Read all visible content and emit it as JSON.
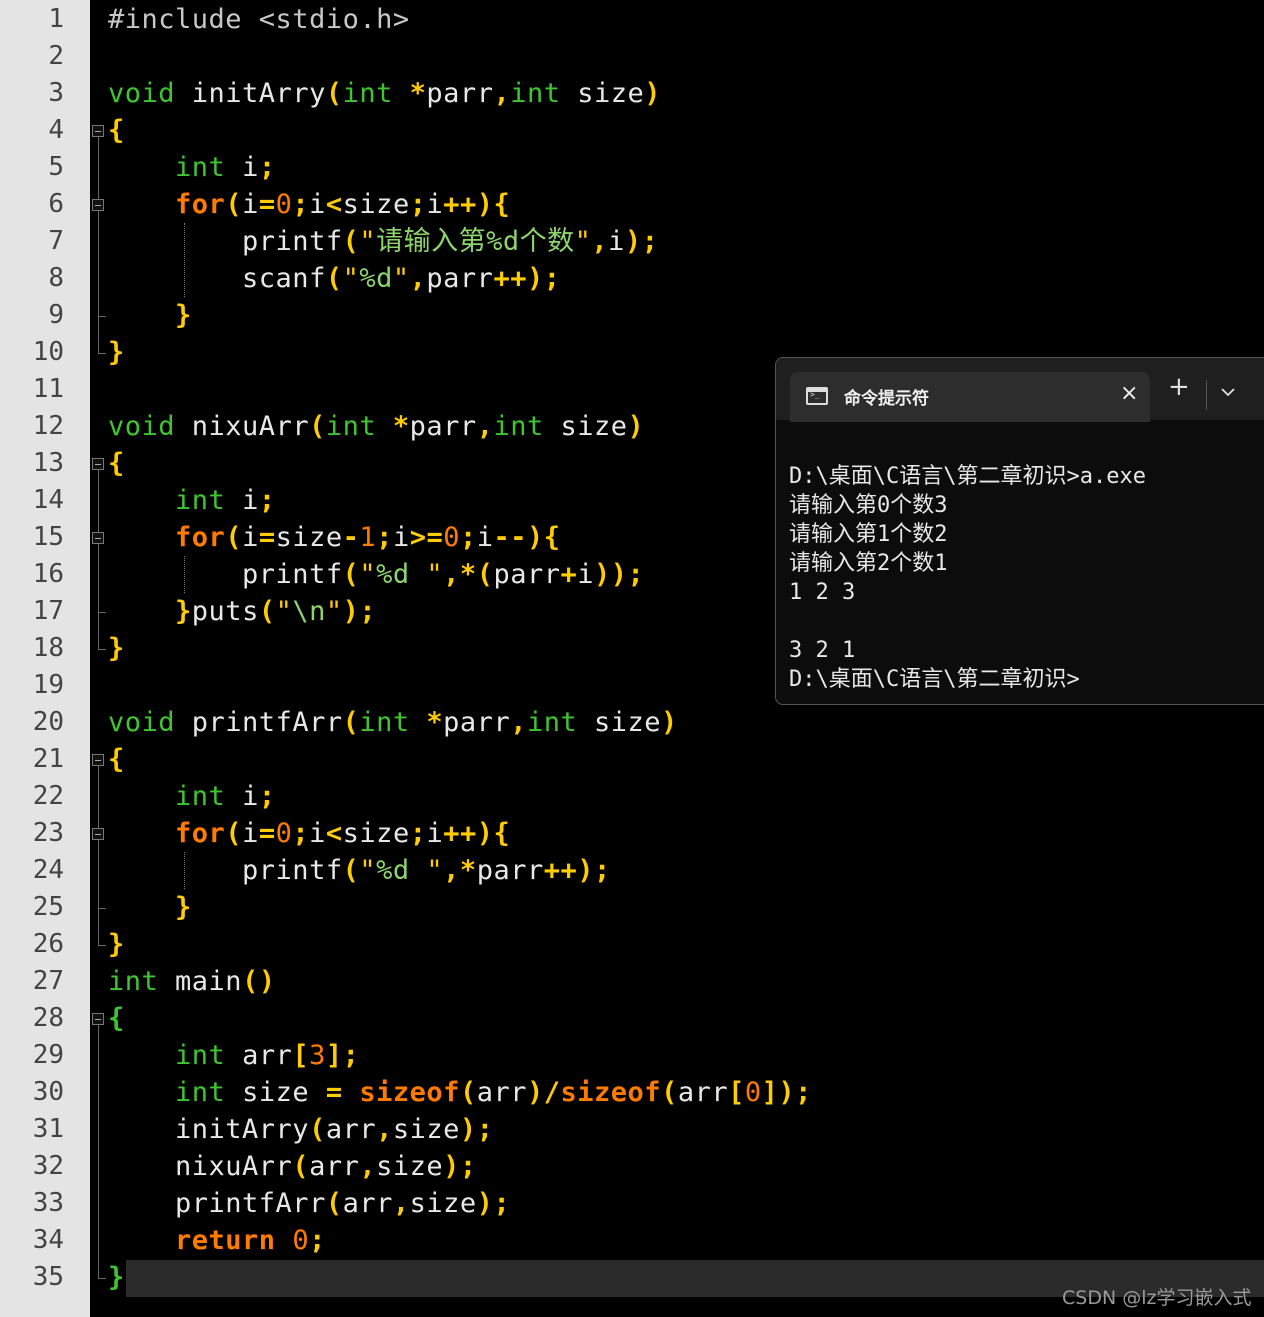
{
  "editor": {
    "line_numbers": [
      "1",
      "2",
      "3",
      "4",
      "5",
      "6",
      "7",
      "8",
      "9",
      "10",
      "11",
      "12",
      "13",
      "14",
      "15",
      "16",
      "17",
      "18",
      "19",
      "20",
      "21",
      "22",
      "23",
      "24",
      "25",
      "26",
      "27",
      "28",
      "29",
      "30",
      "31",
      "32",
      "33",
      "34",
      "35"
    ],
    "lines": [
      [
        {
          "t": "#include <stdio.h>",
          "c": "pp"
        }
      ],
      [],
      [
        {
          "t": "void",
          "c": "kw-type"
        },
        {
          "t": " initArry",
          "c": ""
        },
        {
          "t": "(",
          "c": "op"
        },
        {
          "t": "int",
          "c": "kw-type"
        },
        {
          "t": " ",
          "c": ""
        },
        {
          "t": "*",
          "c": "op"
        },
        {
          "t": "parr",
          "c": ""
        },
        {
          "t": ",",
          "c": "op"
        },
        {
          "t": "int",
          "c": "kw-type"
        },
        {
          "t": " size",
          "c": ""
        },
        {
          "t": ")",
          "c": "op"
        }
      ],
      [
        {
          "t": "{",
          "c": "brace"
        }
      ],
      [
        {
          "t": "    ",
          "c": ""
        },
        {
          "t": "int",
          "c": "kw-type"
        },
        {
          "t": " i",
          "c": ""
        },
        {
          "t": ";",
          "c": "op"
        }
      ],
      [
        {
          "t": "    ",
          "c": ""
        },
        {
          "t": "for",
          "c": "kw-ctrl"
        },
        {
          "t": "(",
          "c": "op"
        },
        {
          "t": "i",
          "c": ""
        },
        {
          "t": "=",
          "c": "op"
        },
        {
          "t": "0",
          "c": "num"
        },
        {
          "t": ";",
          "c": "op"
        },
        {
          "t": "i",
          "c": ""
        },
        {
          "t": "<",
          "c": "op"
        },
        {
          "t": "size",
          "c": ""
        },
        {
          "t": ";",
          "c": "op"
        },
        {
          "t": "i",
          "c": ""
        },
        {
          "t": "++",
          "c": "op"
        },
        {
          "t": ")",
          "c": "op"
        },
        {
          "t": "{",
          "c": "brace"
        }
      ],
      [
        {
          "t": "        printf",
          "c": ""
        },
        {
          "t": "(",
          "c": "op"
        },
        {
          "t": "\"",
          "c": "str"
        },
        {
          "t": "请输入第%d个数",
          "c": "strt"
        },
        {
          "t": "\"",
          "c": "str"
        },
        {
          "t": ",",
          "c": "op"
        },
        {
          "t": "i",
          "c": ""
        },
        {
          "t": ")",
          "c": "op"
        },
        {
          "t": ";",
          "c": "op"
        }
      ],
      [
        {
          "t": "        scanf",
          "c": ""
        },
        {
          "t": "(",
          "c": "op"
        },
        {
          "t": "\"",
          "c": "str"
        },
        {
          "t": "%d",
          "c": "strt"
        },
        {
          "t": "\"",
          "c": "str"
        },
        {
          "t": ",",
          "c": "op"
        },
        {
          "t": "parr",
          "c": ""
        },
        {
          "t": "++",
          "c": "op"
        },
        {
          "t": ")",
          "c": "op"
        },
        {
          "t": ";",
          "c": "op"
        }
      ],
      [
        {
          "t": "    ",
          "c": ""
        },
        {
          "t": "}",
          "c": "brace"
        }
      ],
      [
        {
          "t": "}",
          "c": "brace"
        }
      ],
      [],
      [
        {
          "t": "void",
          "c": "kw-type"
        },
        {
          "t": " nixuArr",
          "c": ""
        },
        {
          "t": "(",
          "c": "op"
        },
        {
          "t": "int",
          "c": "kw-type"
        },
        {
          "t": " ",
          "c": ""
        },
        {
          "t": "*",
          "c": "op"
        },
        {
          "t": "parr",
          "c": ""
        },
        {
          "t": ",",
          "c": "op"
        },
        {
          "t": "int",
          "c": "kw-type"
        },
        {
          "t": " size",
          "c": ""
        },
        {
          "t": ")",
          "c": "op"
        }
      ],
      [
        {
          "t": "{",
          "c": "brace"
        }
      ],
      [
        {
          "t": "    ",
          "c": ""
        },
        {
          "t": "int",
          "c": "kw-type"
        },
        {
          "t": " i",
          "c": ""
        },
        {
          "t": ";",
          "c": "op"
        }
      ],
      [
        {
          "t": "    ",
          "c": ""
        },
        {
          "t": "for",
          "c": "kw-ctrl"
        },
        {
          "t": "(",
          "c": "op"
        },
        {
          "t": "i",
          "c": ""
        },
        {
          "t": "=",
          "c": "op"
        },
        {
          "t": "size",
          "c": ""
        },
        {
          "t": "-",
          "c": "op"
        },
        {
          "t": "1",
          "c": "num"
        },
        {
          "t": ";",
          "c": "op"
        },
        {
          "t": "i",
          "c": ""
        },
        {
          "t": ">=",
          "c": "op"
        },
        {
          "t": "0",
          "c": "num"
        },
        {
          "t": ";",
          "c": "op"
        },
        {
          "t": "i",
          "c": ""
        },
        {
          "t": "--",
          "c": "op"
        },
        {
          "t": ")",
          "c": "op"
        },
        {
          "t": "{",
          "c": "brace"
        }
      ],
      [
        {
          "t": "        printf",
          "c": ""
        },
        {
          "t": "(",
          "c": "op"
        },
        {
          "t": "\"",
          "c": "str"
        },
        {
          "t": "%d ",
          "c": "strt"
        },
        {
          "t": "\"",
          "c": "str"
        },
        {
          "t": ",",
          "c": "op"
        },
        {
          "t": "*",
          "c": "op"
        },
        {
          "t": "(",
          "c": "op"
        },
        {
          "t": "parr",
          "c": ""
        },
        {
          "t": "+",
          "c": "op"
        },
        {
          "t": "i",
          "c": ""
        },
        {
          "t": ")",
          "c": "op"
        },
        {
          "t": ")",
          "c": "op"
        },
        {
          "t": ";",
          "c": "op"
        }
      ],
      [
        {
          "t": "    ",
          "c": ""
        },
        {
          "t": "}",
          "c": "brace"
        },
        {
          "t": "puts",
          "c": ""
        },
        {
          "t": "(",
          "c": "op"
        },
        {
          "t": "\"",
          "c": "str"
        },
        {
          "t": "\\n",
          "c": "strt"
        },
        {
          "t": "\"",
          "c": "str"
        },
        {
          "t": ")",
          "c": "op"
        },
        {
          "t": ";",
          "c": "op"
        }
      ],
      [
        {
          "t": "}",
          "c": "brace"
        }
      ],
      [],
      [
        {
          "t": "void",
          "c": "kw-type"
        },
        {
          "t": " printfArr",
          "c": ""
        },
        {
          "t": "(",
          "c": "op"
        },
        {
          "t": "int",
          "c": "kw-type"
        },
        {
          "t": " ",
          "c": ""
        },
        {
          "t": "*",
          "c": "op"
        },
        {
          "t": "parr",
          "c": ""
        },
        {
          "t": ",",
          "c": "op"
        },
        {
          "t": "int",
          "c": "kw-type"
        },
        {
          "t": " size",
          "c": ""
        },
        {
          "t": ")",
          "c": "op"
        }
      ],
      [
        {
          "t": "{",
          "c": "brace"
        }
      ],
      [
        {
          "t": "    ",
          "c": ""
        },
        {
          "t": "int",
          "c": "kw-type"
        },
        {
          "t": " i",
          "c": ""
        },
        {
          "t": ";",
          "c": "op"
        }
      ],
      [
        {
          "t": "    ",
          "c": ""
        },
        {
          "t": "for",
          "c": "kw-ctrl"
        },
        {
          "t": "(",
          "c": "op"
        },
        {
          "t": "i",
          "c": ""
        },
        {
          "t": "=",
          "c": "op"
        },
        {
          "t": "0",
          "c": "num"
        },
        {
          "t": ";",
          "c": "op"
        },
        {
          "t": "i",
          "c": ""
        },
        {
          "t": "<",
          "c": "op"
        },
        {
          "t": "size",
          "c": ""
        },
        {
          "t": ";",
          "c": "op"
        },
        {
          "t": "i",
          "c": ""
        },
        {
          "t": "++",
          "c": "op"
        },
        {
          "t": ")",
          "c": "op"
        },
        {
          "t": "{",
          "c": "brace"
        }
      ],
      [
        {
          "t": "        printf",
          "c": ""
        },
        {
          "t": "(",
          "c": "op"
        },
        {
          "t": "\"",
          "c": "str"
        },
        {
          "t": "%d ",
          "c": "strt"
        },
        {
          "t": "\"",
          "c": "str"
        },
        {
          "t": ",",
          "c": "op"
        },
        {
          "t": "*",
          "c": "op"
        },
        {
          "t": "parr",
          "c": ""
        },
        {
          "t": "++",
          "c": "op"
        },
        {
          "t": ")",
          "c": "op"
        },
        {
          "t": ";",
          "c": "op"
        }
      ],
      [
        {
          "t": "    ",
          "c": ""
        },
        {
          "t": "}",
          "c": "brace"
        }
      ],
      [
        {
          "t": "}",
          "c": "brace"
        }
      ],
      [
        {
          "t": "int",
          "c": "kw-type"
        },
        {
          "t": " main",
          "c": ""
        },
        {
          "t": "()",
          "c": "op"
        }
      ],
      [
        {
          "t": "{",
          "c": "brace-g"
        }
      ],
      [
        {
          "t": "    ",
          "c": ""
        },
        {
          "t": "int",
          "c": "kw-type"
        },
        {
          "t": " arr",
          "c": ""
        },
        {
          "t": "[",
          "c": "op"
        },
        {
          "t": "3",
          "c": "num"
        },
        {
          "t": "]",
          "c": "op"
        },
        {
          "t": ";",
          "c": "op"
        }
      ],
      [
        {
          "t": "    ",
          "c": ""
        },
        {
          "t": "int",
          "c": "kw-type"
        },
        {
          "t": " size ",
          "c": ""
        },
        {
          "t": "=",
          "c": "op"
        },
        {
          "t": " ",
          "c": ""
        },
        {
          "t": "sizeof",
          "c": "kw-ctrl"
        },
        {
          "t": "(",
          "c": "op"
        },
        {
          "t": "arr",
          "c": ""
        },
        {
          "t": ")",
          "c": "op"
        },
        {
          "t": "/",
          "c": "op"
        },
        {
          "t": "sizeof",
          "c": "kw-ctrl"
        },
        {
          "t": "(",
          "c": "op"
        },
        {
          "t": "arr",
          "c": ""
        },
        {
          "t": "[",
          "c": "op"
        },
        {
          "t": "0",
          "c": "num"
        },
        {
          "t": "]",
          "c": "op"
        },
        {
          "t": ")",
          "c": "op"
        },
        {
          "t": ";",
          "c": "op"
        }
      ],
      [
        {
          "t": "    initArry",
          "c": ""
        },
        {
          "t": "(",
          "c": "op"
        },
        {
          "t": "arr",
          "c": ""
        },
        {
          "t": ",",
          "c": "op"
        },
        {
          "t": "size",
          "c": ""
        },
        {
          "t": ")",
          "c": "op"
        },
        {
          "t": ";",
          "c": "op"
        }
      ],
      [
        {
          "t": "    nixuArr",
          "c": ""
        },
        {
          "t": "(",
          "c": "op"
        },
        {
          "t": "arr",
          "c": ""
        },
        {
          "t": ",",
          "c": "op"
        },
        {
          "t": "size",
          "c": ""
        },
        {
          "t": ")",
          "c": "op"
        },
        {
          "t": ";",
          "c": "op"
        }
      ],
      [
        {
          "t": "    printfArr",
          "c": ""
        },
        {
          "t": "(",
          "c": "op"
        },
        {
          "t": "arr",
          "c": ""
        },
        {
          "t": ",",
          "c": "op"
        },
        {
          "t": "size",
          "c": ""
        },
        {
          "t": ")",
          "c": "op"
        },
        {
          "t": ";",
          "c": "op"
        }
      ],
      [
        {
          "t": "    ",
          "c": ""
        },
        {
          "t": "return",
          "c": "kw-ctrl"
        },
        {
          "t": " ",
          "c": ""
        },
        {
          "t": "0",
          "c": "num"
        },
        {
          "t": ";",
          "c": "op"
        }
      ],
      [
        {
          "t": "}",
          "c": "brace-g"
        }
      ]
    ]
  },
  "terminal": {
    "tab_title": "命令提示符",
    "close_glyph": "×",
    "new_tab_glyph": "+",
    "output": [
      "D:\\桌面\\C语言\\第二章初识>a.exe",
      "请输入第0个数3",
      "请输入第1个数2",
      "请输入第2个数1",
      "1 2 3",
      "",
      "3 2 1",
      "D:\\桌面\\C语言\\第二章初识>"
    ]
  },
  "watermark": "CSDN @lz学习嵌入式",
  "colors": {
    "type_keyword": "#3fc52f",
    "control_keyword": "#ff7b00",
    "operator": "#ffcc00",
    "string_text": "#8cd46c",
    "default_text": "#e8e8e8"
  }
}
